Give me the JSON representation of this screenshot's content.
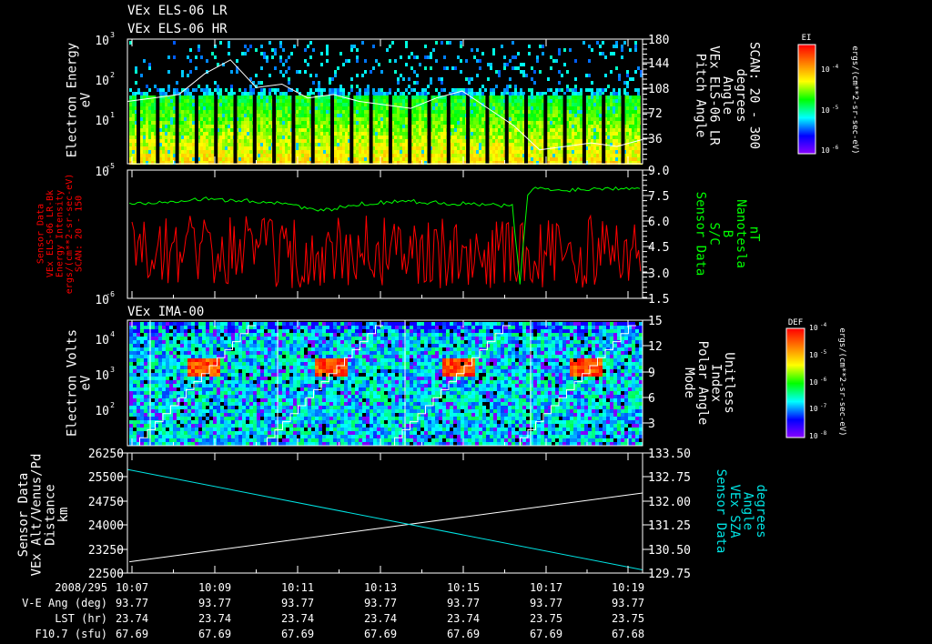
{
  "titles": {
    "line1": "VEx ELS-06 LR",
    "line2": "VEx ELS-06 HR",
    "ima": "VEx IMA-00"
  },
  "colors": {
    "green": "#00ff00",
    "red": "#ff0000",
    "cyan": "#00e5e5",
    "white": "#ffffff"
  },
  "chart_data": [
    {
      "type": "heatmap",
      "name": "els-spectrogram",
      "ylabel": [
        "Electron Energy",
        "eV"
      ],
      "yticks": [
        "10",
        "10",
        "10"
      ],
      "ytick_exps": [
        "1",
        "2",
        "3"
      ],
      "ylim_log10": [
        0,
        3
      ],
      "right_axis": {
        "label": [
          "Pitch Angle",
          "VEx ELS-06 LR",
          "Angle",
          "degrees",
          "SCAN: 20 - 300"
        ],
        "ticks": [
          "36",
          "72",
          "108",
          "144",
          "180"
        ],
        "ylim": [
          0,
          180
        ]
      },
      "colorbar": {
        "title": "EI",
        "ticks": [
          "10",
          "10",
          "10"
        ],
        "tick_exps": [
          "-4",
          "-5",
          "-6"
        ],
        "label": "ergs/(cm**2-sr-sec-eV)"
      },
      "pitch_angle_overlay": [
        90,
        95,
        100,
        130,
        150,
        110,
        115,
        95,
        100,
        90,
        85,
        80,
        95,
        105,
        80,
        55,
        20,
        25,
        30,
        25,
        35
      ]
    },
    {
      "type": "line",
      "name": "intensity-and-b",
      "left_axis": {
        "label": [
          "Sensor Data",
          "VEx ELS-06 LR-Bk",
          "Energy Intensity",
          "ergs/(cm**2-sr-sec-eV)",
          "SCAN: 20 - 150"
        ],
        "ticks": [
          "10",
          "10"
        ],
        "tick_exps": [
          "-6",
          "-5"
        ],
        "ylim": [
          1e-06,
          1e-05
        ]
      },
      "right_axis": {
        "label": [
          "Sensor Data",
          "S/C",
          "B",
          "Nanotesla",
          "nT"
        ],
        "ticks": [
          "1.5",
          "3.0",
          "4.5",
          "6.0",
          "7.5",
          "9.0"
        ],
        "ylim": [
          1.5,
          9.0
        ]
      },
      "series": [
        {
          "name": "Energy Intensity",
          "color": "#ff0000",
          "axis": "left",
          "values_log_range": [
            1.8e-06,
            6e-06
          ]
        },
        {
          "name": "B",
          "color": "#00ff00",
          "axis": "right",
          "x_min": [
            0,
            1,
            2,
            3,
            4,
            5,
            6,
            7,
            8,
            9,
            10,
            10.2,
            10.4,
            10.6,
            11,
            12,
            13.4
          ],
          "y": [
            7.0,
            7.2,
            7.3,
            7.2,
            7.1,
            6.6,
            7.0,
            7.2,
            7.1,
            7.0,
            6.9,
            2.3,
            7.6,
            8.0,
            7.8,
            7.9,
            8.0
          ]
        }
      ]
    },
    {
      "type": "heatmap",
      "name": "ima-spectrogram",
      "ylabel": [
        "Electron Volts",
        "eV"
      ],
      "yticks": [
        "10",
        "10",
        "10"
      ],
      "ytick_exps": [
        "2",
        "3",
        "4"
      ],
      "ylim_log10": [
        1,
        4.6
      ],
      "right_axis": {
        "label": [
          "Mode",
          "Polar Angle",
          "Index",
          "Unitless"
        ],
        "ticks": [
          "3",
          "6",
          "9",
          "12",
          "15"
        ],
        "ylim": [
          0,
          15
        ]
      },
      "colorbar": {
        "title": "DEF",
        "ticks": [
          "10",
          "10",
          "10",
          "10",
          "10"
        ],
        "tick_exps": [
          "-4",
          "-5",
          "-6",
          "-7",
          "-8"
        ],
        "label": "ergs/(cm**2-sr-sec-eV)"
      }
    },
    {
      "type": "line",
      "name": "distance-and-sza",
      "left_axis": {
        "label": [
          "Sensor Data",
          "VEx Alt/Venus/Pd",
          "Distance",
          "km"
        ],
        "ticks": [
          "22500",
          "23250",
          "24000",
          "24750",
          "25500",
          "26250"
        ],
        "ylim": [
          22500,
          26250
        ]
      },
      "right_axis": {
        "label": [
          "Sensor Data",
          "VEx SZA",
          "Angle",
          "degrees"
        ],
        "ticks": [
          "129.75",
          "130.50",
          "131.25",
          "132.00",
          "132.75",
          "133.50"
        ],
        "ylim": [
          129.75,
          133.5
        ]
      },
      "series": [
        {
          "name": "Distance",
          "color": "#ffffff",
          "axis": "left",
          "x_min": [
            0,
            13.4
          ],
          "y": [
            22850,
            25000
          ]
        },
        {
          "name": "SZA",
          "color": "#00e5e5",
          "axis": "right",
          "x_min": [
            0,
            13.4
          ],
          "y": [
            132.9,
            129.85
          ]
        }
      ]
    }
  ],
  "time_axis": {
    "date": "2008/295",
    "ticks": [
      "10:07",
      "10:09",
      "10:11",
      "10:13",
      "10:15",
      "10:17",
      "10:19"
    ],
    "rows": [
      {
        "label": "V-E Ang (deg)",
        "values": [
          "93.77",
          "93.77",
          "93.77",
          "93.77",
          "93.77",
          "93.77",
          "93.77"
        ]
      },
      {
        "label": "LST (hr)",
        "values": [
          "23.74",
          "23.74",
          "23.74",
          "23.74",
          "23.74",
          "23.75",
          "23.75"
        ]
      },
      {
        "label": "F10.7 (sfu)",
        "values": [
          "67.69",
          "67.69",
          "67.69",
          "67.69",
          "67.69",
          "67.69",
          "67.68"
        ]
      }
    ]
  }
}
